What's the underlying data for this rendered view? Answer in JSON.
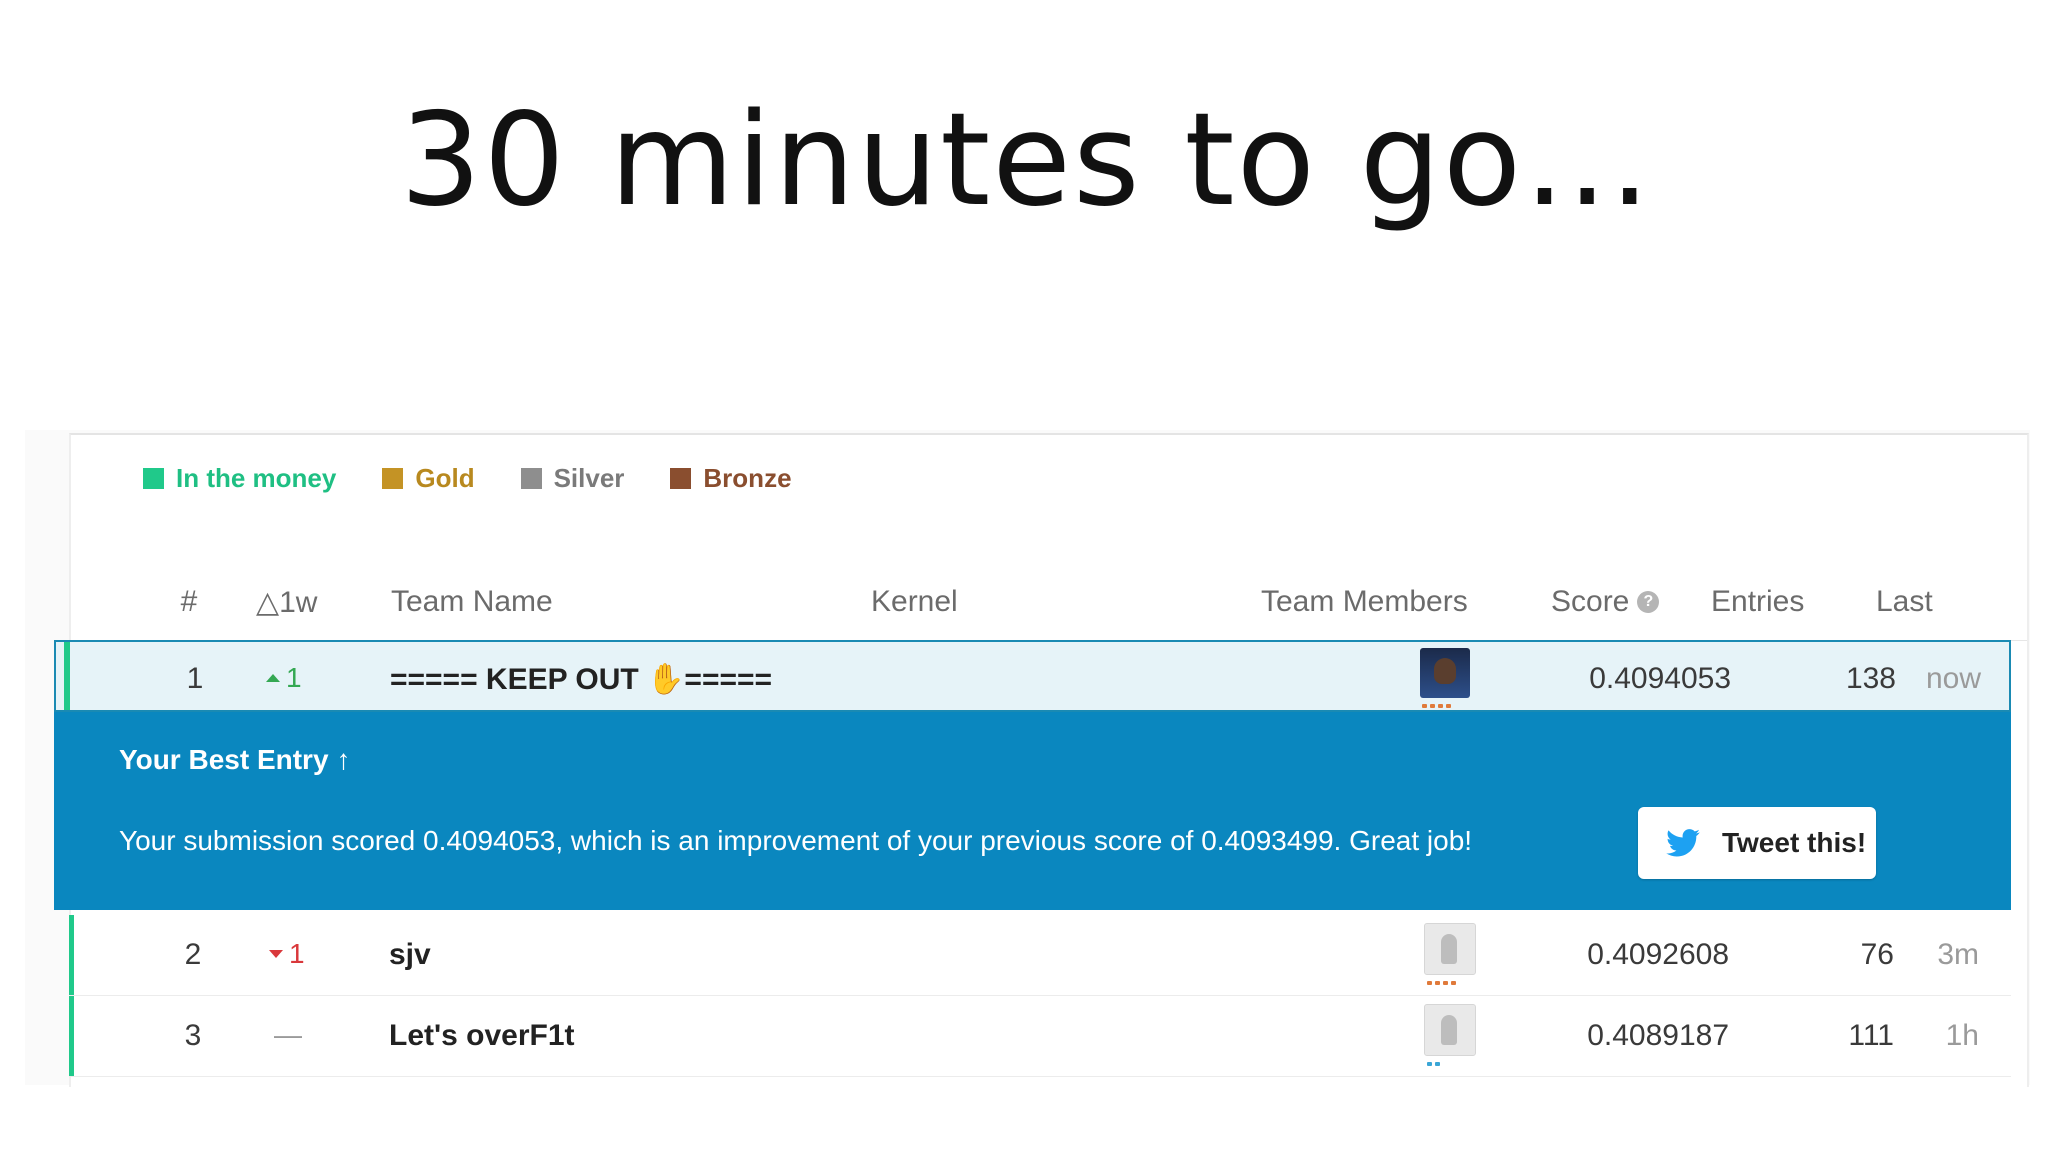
{
  "slide": {
    "title": "30 minutes to go…"
  },
  "legend": [
    {
      "label": "In the money",
      "color": "#20c98a",
      "text_color": "#1fbf83"
    },
    {
      "label": "Gold",
      "color": "#c49325",
      "text_color": "#b8891f"
    },
    {
      "label": "Silver",
      "color": "#8e8e8e",
      "text_color": "#7a7a7a"
    },
    {
      "label": "Bronze",
      "color": "#8a4e2f",
      "text_color": "#8a4e2f"
    }
  ],
  "headers": {
    "rank": "#",
    "delta": "△1w",
    "team": "Team Name",
    "kernel": "Kernel",
    "members": "Team Members",
    "score": "Score",
    "entries": "Entries",
    "last": "Last"
  },
  "rows": [
    {
      "rank": "1",
      "delta": "1",
      "delta_dir": "up",
      "team": "===== KEEP OUT ✋=====",
      "score": "0.4094053",
      "entries": "138",
      "last": "now",
      "avatar": "person-photo",
      "tier_dots": "#e07a3b"
    },
    {
      "rank": "2",
      "delta": "1",
      "delta_dir": "down",
      "team": "sjv",
      "score": "0.4092608",
      "entries": "76",
      "last": "3m",
      "avatar": "default-bird",
      "tier_dots": "#e07a3b"
    },
    {
      "rank": "3",
      "delta": "—",
      "delta_dir": "none",
      "team": "Let's overF1t",
      "score": "0.4089187",
      "entries": "111",
      "last": "1h",
      "avatar": "default-bird",
      "tier_dots": "#3aa6d6"
    }
  ],
  "best_entry": {
    "title": "Your Best Entry",
    "message": "Your submission scored 0.4094053, which is an improvement of your previous score of 0.4093499. Great job!",
    "tweet_label": "Tweet this!"
  },
  "colors": {
    "accent_green": "#20c98a",
    "best_bar": "#0a87bf",
    "highlight_row": "#e6f3f8",
    "highlight_border": "#1a8ab3",
    "delta_up": "#34a853",
    "delta_down": "#d9383b",
    "twitter": "#1da1f2"
  }
}
